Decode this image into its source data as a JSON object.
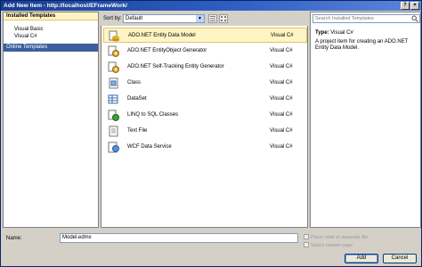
{
  "window": {
    "title": "Add New Item - http://localhost/EFrameWork/"
  },
  "left_panel": {
    "header": "Installed Templates",
    "tree": [
      "Visual Basic",
      "Visual C#"
    ],
    "online": "Online Templates"
  },
  "toolbar": {
    "sort_label": "Sort by:",
    "sort_value": "Default"
  },
  "templates": [
    {
      "name": "ADO.NET Entity Data Model",
      "lang": "Visual C#",
      "icon": "entity-model-icon"
    },
    {
      "name": "ADO.NET EntityObject Generator",
      "lang": "Visual C#",
      "icon": "generator-icon"
    },
    {
      "name": "ADO.NET Self-Tracking Entity Generator",
      "lang": "Visual C#",
      "icon": "generator-icon"
    },
    {
      "name": "Class",
      "lang": "Visual C#",
      "icon": "class-icon"
    },
    {
      "name": "DataSet",
      "lang": "Visual C#",
      "icon": "dataset-icon"
    },
    {
      "name": "LINQ to SQL Classes",
      "lang": "Visual C#",
      "icon": "linq-icon"
    },
    {
      "name": "Text File",
      "lang": "Visual C#",
      "icon": "text-file-icon"
    },
    {
      "name": "WCF Data Service",
      "lang": "Visual C#",
      "icon": "wcf-icon"
    }
  ],
  "details": {
    "search_placeholder": "Search Installed Templates",
    "type_label": "Type:",
    "type_value": "Visual C#",
    "description": "A project item for creating an ADO.NET Entity Data Model."
  },
  "bottom": {
    "name_label": "Name:",
    "name_value": "Model.edmx",
    "chk1": "Place code in separate file",
    "chk2": "Select master page",
    "add_label": "Add",
    "cancel_label": "Cancel"
  },
  "colors": {
    "title_bar": "#1b3d8f",
    "selected_bg": "#fff4c4",
    "online_selected": "#3c5e9c"
  }
}
